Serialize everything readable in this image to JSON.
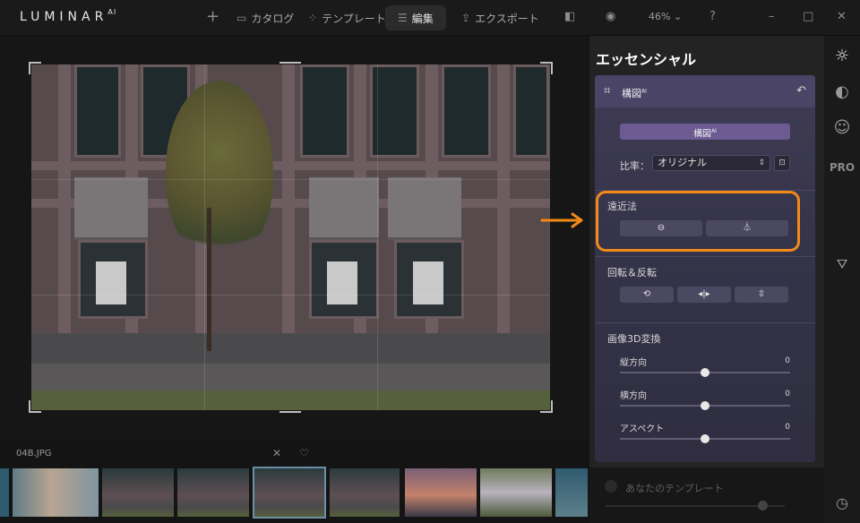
{
  "app": {
    "logo": "LUMINAR",
    "logo_sup": "AI"
  },
  "nav": {
    "catalog": "カタログ",
    "templates": "テンプレート",
    "edit": "編集",
    "export": "エクスポート",
    "zoom": "46%"
  },
  "file": {
    "name": "04B.JPG"
  },
  "panel": {
    "title": "エッセンシャル",
    "card_title": "構図",
    "card_title_sup": "AI",
    "ai_button": "構図",
    "ai_button_sup": "AI",
    "ratio_label": "比率：",
    "ratio_value": "オリジナル",
    "perspective": {
      "label": "遠近法"
    },
    "rotate": {
      "label": "回転＆反転"
    },
    "transform3d": {
      "label": "画像3D変換",
      "sliders": [
        {
          "label": "縦方向",
          "value": "0"
        },
        {
          "label": "横方向",
          "value": "0"
        },
        {
          "label": "アスペクト",
          "value": "0"
        }
      ]
    }
  },
  "templates": {
    "label": "あなたのテンプレート"
  },
  "rail": {
    "pro": "PRO"
  },
  "colors": {
    "highlight": "#f28a18",
    "accent_purple": "#6d5a92",
    "selected_thumb": "#6b8fa6"
  }
}
